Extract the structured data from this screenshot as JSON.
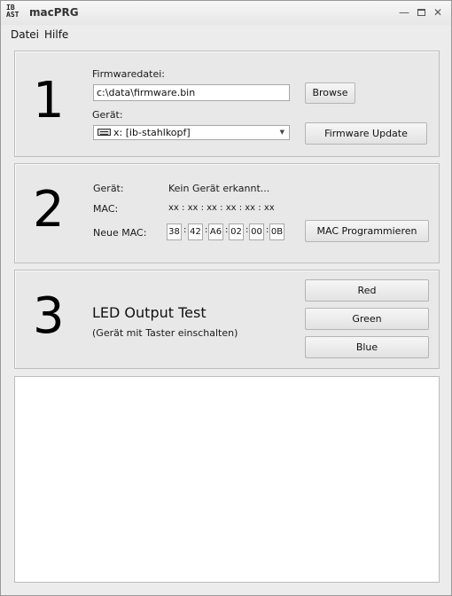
{
  "window": {
    "title": "macPRG",
    "icon_top": "IB",
    "icon_bottom": "AST",
    "icons": [
      "minimize-icon",
      "maximize-icon",
      "close-icon"
    ]
  },
  "menu": {
    "items": [
      "Datei",
      "Hilfe"
    ]
  },
  "step1": {
    "number": "1",
    "firmware_label": "Firmwaredatei:",
    "firmware_path": "c:\\data\\firmware.bin",
    "browse_label": "Browse",
    "device_label": "Gerät:",
    "device_value": "x: [ib-stahlkopf]",
    "update_label": "Firmware Update"
  },
  "step2": {
    "number": "2",
    "device_label": "Gerät:",
    "device_status": "Kein Gerät erkannt...",
    "mac_label": "MAC:",
    "mac_value": "xx : xx : xx : xx : xx : xx",
    "new_mac_label": "Neue MAC:",
    "new_mac_octets": [
      "38",
      "42",
      "A6",
      "02",
      "00",
      "0B"
    ],
    "program_label": "MAC Programmieren"
  },
  "step3": {
    "number": "3",
    "title": "LED Output Test",
    "hint": "(Gerät mit Taster einschalten)",
    "buttons": [
      "Red",
      "Green",
      "Blue"
    ]
  },
  "output": {
    "text": ""
  }
}
